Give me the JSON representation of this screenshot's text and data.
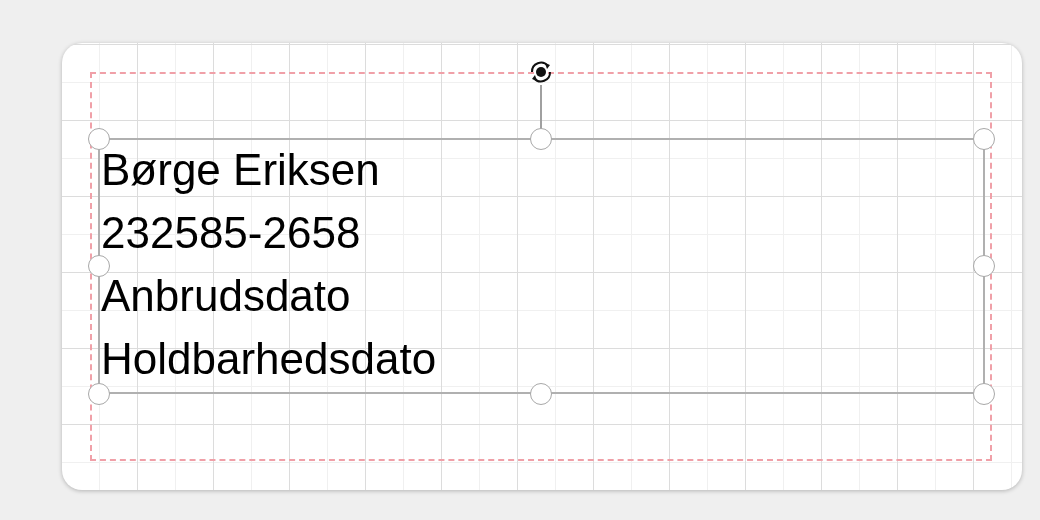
{
  "canvas": {
    "text_box": {
      "selected": true,
      "lines": [
        "Børge Eriksen",
        "232585-2658",
        "Anbrudsdato",
        "Holdbarhedsdato"
      ]
    }
  }
}
